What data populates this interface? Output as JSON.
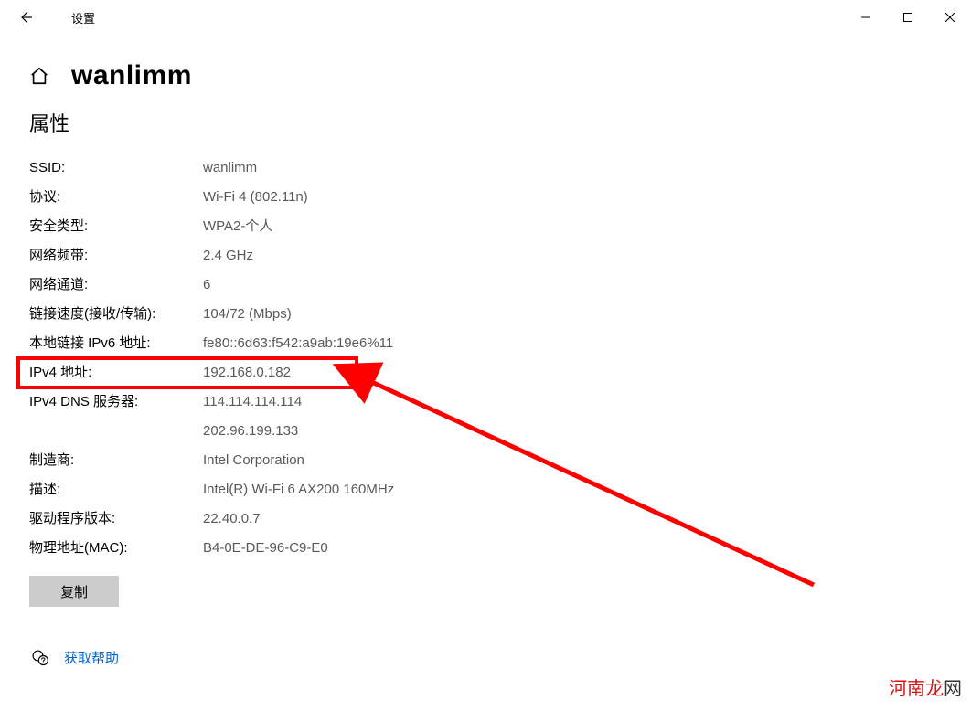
{
  "titlebar": {
    "title": "设置"
  },
  "page": {
    "title": "wanlimm",
    "section": "属性"
  },
  "props": {
    "ssid_label": "SSID:",
    "ssid_value": "wanlimm",
    "protocol_label": "协议:",
    "protocol_value": "Wi-Fi 4 (802.11n)",
    "security_label": "安全类型:",
    "security_value": "WPA2-个人",
    "band_label": "网络频带:",
    "band_value": "2.4 GHz",
    "channel_label": "网络通道:",
    "channel_value": "6",
    "linkspeed_label": "链接速度(接收/传输):",
    "linkspeed_value": "104/72 (Mbps)",
    "ipv6local_label": "本地链接 IPv6 地址:",
    "ipv6local_value": "fe80::6d63:f542:a9ab:19e6%11",
    "ipv4_label": "IPv4 地址:",
    "ipv4_value": "192.168.0.182",
    "dns_label": "IPv4 DNS 服务器:",
    "dns_value": "114.114.114.114\n202.96.199.133",
    "vendor_label": "制造商:",
    "vendor_value": "Intel Corporation",
    "desc_label": "描述:",
    "desc_value": "Intel(R) Wi-Fi 6 AX200 160MHz",
    "driver_label": "驱动程序版本:",
    "driver_value": "22.40.0.7",
    "mac_label": "物理地址(MAC):",
    "mac_value": "B4-0E-DE-96-C9-E0"
  },
  "buttons": {
    "copy": "复制"
  },
  "help": {
    "label": "获取帮助"
  },
  "watermark": {
    "brand": "河南龙",
    "suffix": "网"
  }
}
